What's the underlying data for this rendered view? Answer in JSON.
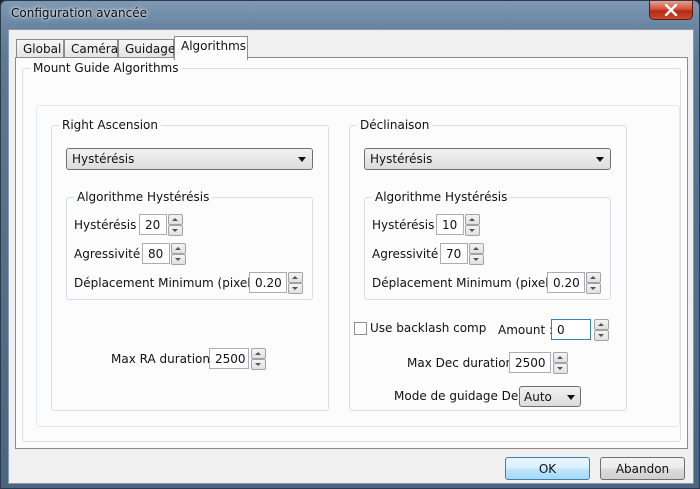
{
  "window": {
    "title": "Configuration avancée"
  },
  "tabs": [
    {
      "label": "Global"
    },
    {
      "label": "Caméra"
    },
    {
      "label": "Guidage"
    },
    {
      "label": "Algorithms"
    }
  ],
  "active_tab": "Algorithms",
  "panel": {
    "title": "Mount Guide Algorithms",
    "ra": {
      "title": "Right Ascension",
      "algorithm": "Hystérésis",
      "subgroup_title": "Algorithme Hystérésis",
      "hysteresis_label": "Hystérésis :",
      "hysteresis_value": "20",
      "aggressiveness_label": "Agressivité :",
      "aggressiveness_value": "80",
      "min_move_label": "Déplacement Minimum (pixels) :",
      "min_move_value": "0.20",
      "max_duration_label": "Max RA duration :",
      "max_duration_value": "2500"
    },
    "dec": {
      "title": "Déclinaison",
      "algorithm": "Hystérésis",
      "subgroup_title": "Algorithme Hystérésis",
      "hysteresis_label": "Hystérésis :",
      "hysteresis_value": "10",
      "aggressiveness_label": "Agressivité :",
      "aggressiveness_value": "70",
      "min_move_label": "Déplacement Minimum (pixels) :",
      "min_move_value": "0.20",
      "backlash_label": "Use backlash comp",
      "backlash_checked": false,
      "amount_label": "Amount :",
      "amount_value": "0",
      "max_duration_label": "Max Dec duration :",
      "max_duration_value": "2500",
      "guide_mode_label": "Mode de guidage Dec :",
      "guide_mode_value": "Auto"
    }
  },
  "buttons": {
    "ok": "OK",
    "cancel": "Abandon"
  },
  "colors": {
    "close_button": "#c94a2f",
    "default_button_border": "#3c7fb1"
  }
}
